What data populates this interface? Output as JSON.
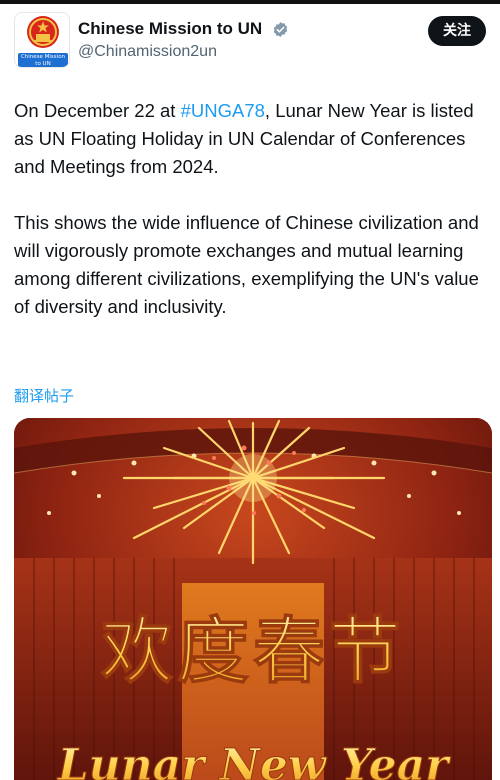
{
  "author": {
    "display_name": "Chinese Mission to UN",
    "handle": "@Chinamission2un",
    "avatar_caption": "Chinese Mission to UN",
    "verified_icon": "verified-badge-icon"
  },
  "follow_label": "关注",
  "post": {
    "paragraph1_before": "On December 22 at ",
    "hashtag": "#UNGA78",
    "paragraph1_after": ", Lunar New Year is listed as UN Floating Holiday in UN Calendar of Conferences and Meetings from 2024.",
    "paragraph2": "This shows the wide influence of Chinese civilization and will vigorously promote exchanges and mutual learning among different civilizations, exemplifying the UN's value of diversity and inclusivity."
  },
  "translate_label": "翻译帖子",
  "media": {
    "chinese_title": "欢度春节",
    "english_title": "Lunar New Year"
  },
  "colors": {
    "accent": "#1d9bf0",
    "text": "#0f1419",
    "secondary": "#536471",
    "gold": "#ffcf4a"
  }
}
